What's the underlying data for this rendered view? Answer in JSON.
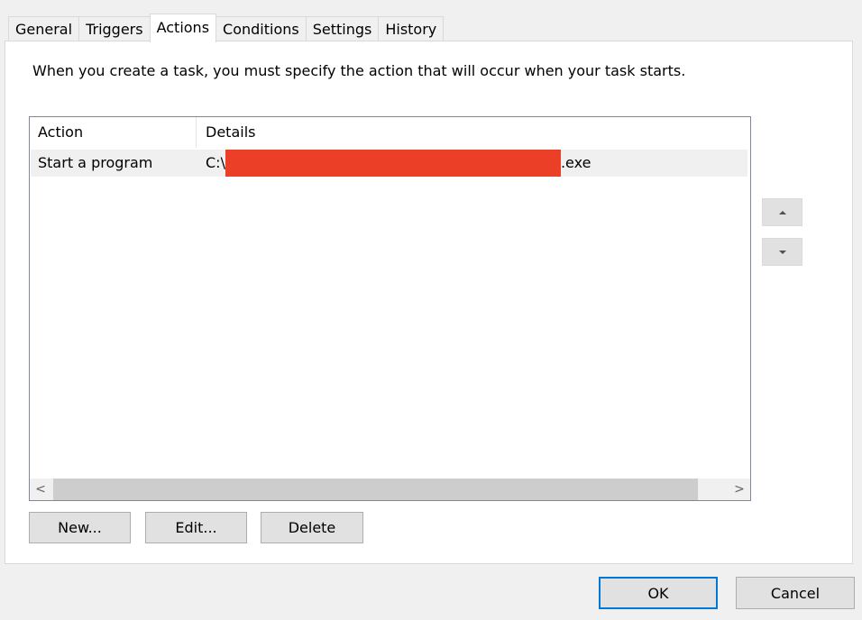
{
  "tabs": [
    {
      "label": "General",
      "active": false
    },
    {
      "label": "Triggers",
      "active": false
    },
    {
      "label": "Actions",
      "active": true
    },
    {
      "label": "Conditions",
      "active": false
    },
    {
      "label": "Settings",
      "active": false
    },
    {
      "label": "History",
      "active": false
    }
  ],
  "actions_page": {
    "description": "When you create a task, you must specify the action that will occur when your task starts.",
    "list": {
      "columns": [
        "Action",
        "Details"
      ],
      "rows": [
        {
          "action": "Start a program",
          "details_prefix": "C:\\",
          "details_suffix": ".exe",
          "redacted": true
        }
      ]
    },
    "scrollbar": {
      "left_arrow": "<",
      "right_arrow": ">"
    },
    "buttons": {
      "new": "New...",
      "edit": "Edit...",
      "delete": "Delete"
    },
    "move_icons": {
      "up": "move-up-icon",
      "down": "move-down-icon"
    }
  },
  "dialog_buttons": {
    "ok": "OK",
    "cancel": "Cancel"
  },
  "colors": {
    "redaction": "#ec3f27",
    "ok_border": "#0078d7",
    "row_highlight": "#f0f0f0"
  }
}
